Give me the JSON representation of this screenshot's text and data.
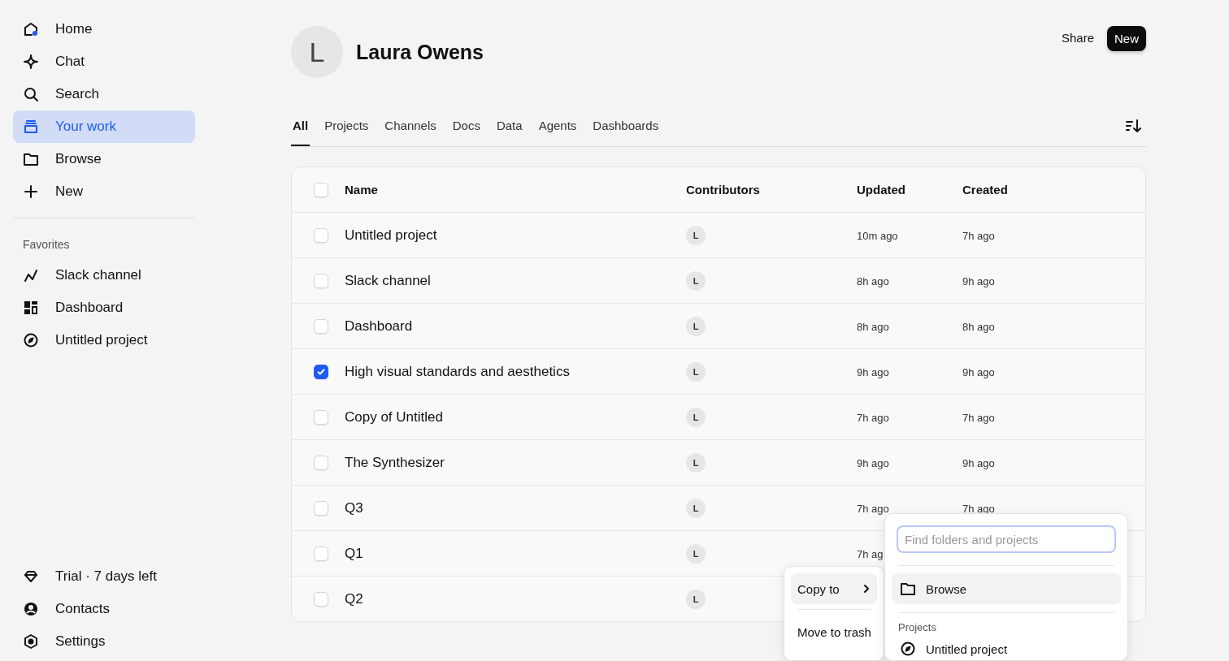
{
  "sidebar": {
    "nav": [
      {
        "label": "Home",
        "selected": false
      },
      {
        "label": "Chat",
        "selected": false
      },
      {
        "label": "Search",
        "selected": false
      },
      {
        "label": "Your work",
        "selected": true
      },
      {
        "label": "Browse",
        "selected": false
      },
      {
        "label": "New",
        "selected": false
      }
    ],
    "favorites_heading": "Favorites",
    "favorites": [
      {
        "label": "Slack channel"
      },
      {
        "label": "Dashboard"
      },
      {
        "label": "Untitled project"
      }
    ],
    "footer": [
      {
        "label": "Trial · 7 days left"
      },
      {
        "label": "Contacts"
      },
      {
        "label": "Settings"
      }
    ]
  },
  "header": {
    "avatar": "L",
    "name": "Laura Owens",
    "share": "Share",
    "new": "New"
  },
  "tabs": [
    {
      "label": "All",
      "selected": true
    },
    {
      "label": "Projects",
      "selected": false
    },
    {
      "label": "Channels",
      "selected": false
    },
    {
      "label": "Docs",
      "selected": false
    },
    {
      "label": "Data",
      "selected": false
    },
    {
      "label": "Agents",
      "selected": false
    },
    {
      "label": "Dashboards",
      "selected": false
    }
  ],
  "table": {
    "columns": [
      "Name",
      "Contributors",
      "Updated",
      "Created"
    ],
    "all_checked": false,
    "rows": [
      {
        "name": "Untitled project",
        "contributor": "L",
        "updated": "10m ago",
        "created": "7h ago",
        "checked": false
      },
      {
        "name": "Slack channel",
        "contributor": "L",
        "updated": "8h ago",
        "created": "9h ago",
        "checked": false
      },
      {
        "name": "Dashboard",
        "contributor": "L",
        "updated": "8h ago",
        "created": "8h ago",
        "checked": false
      },
      {
        "name": "High visual standards and aesthetics",
        "contributor": "L",
        "updated": "9h ago",
        "created": "9h ago",
        "checked": true
      },
      {
        "name": "Copy of Untitled",
        "contributor": "L",
        "updated": "7h ago",
        "created": "7h ago",
        "checked": false
      },
      {
        "name": "The Synthesizer",
        "contributor": "L",
        "updated": "9h ago",
        "created": "9h ago",
        "checked": false
      },
      {
        "name": "Q3",
        "contributor": "L",
        "updated": "7h ago",
        "created": "7h ago",
        "checked": false
      },
      {
        "name": "Q1",
        "contributor": "L",
        "updated": "7h ag",
        "checked": false
      },
      {
        "name": "Q2",
        "contributor": "L",
        "checked": false
      }
    ]
  },
  "context_menu": {
    "items": [
      {
        "label": "Copy to",
        "kind": "submenu",
        "selected": true
      },
      {
        "label": "Move to trash",
        "kind": "action",
        "selected": false
      }
    ]
  },
  "submenu": {
    "placeholder": "Find folders and projects",
    "items": [
      {
        "label": "Browse",
        "selected": true
      }
    ],
    "section": "Projects",
    "projects": [
      {
        "label": "Untitled project"
      }
    ]
  }
}
